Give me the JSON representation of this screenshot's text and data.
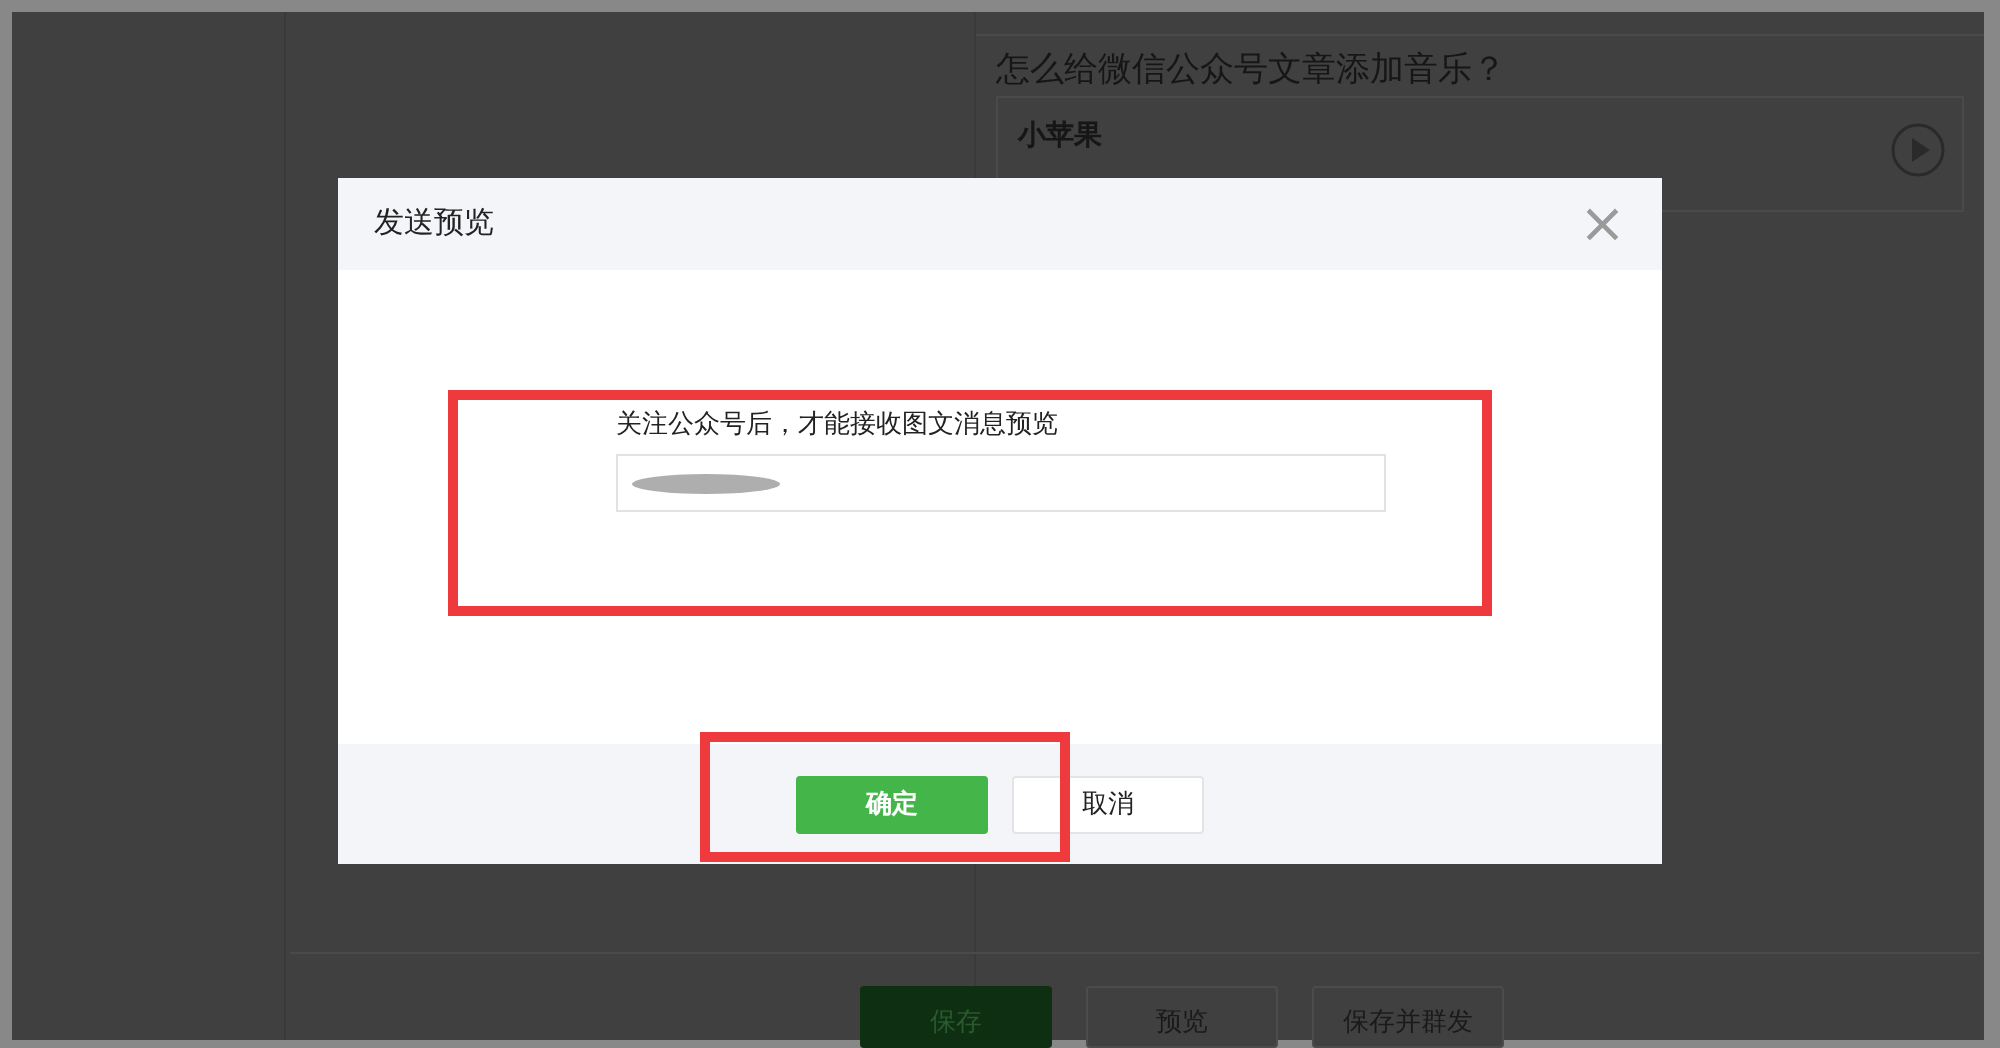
{
  "editor": {
    "article_title": "怎么给微信公众号文章添加音乐？",
    "music_card": {
      "title": "小苹果"
    }
  },
  "bottom_buttons": [
    {
      "label": "保存",
      "kind": "primary"
    },
    {
      "label": "预览",
      "kind": "default"
    },
    {
      "label": "保存并群发",
      "kind": "default"
    }
  ],
  "dialog": {
    "title": "发送预览",
    "close": "×",
    "hint": "关注公众号后，才能接收图文消息预览",
    "field": {
      "redacted": true,
      "highlighted": true
    },
    "buttons": [
      {
        "label": "确定",
        "kind": "primary",
        "highlighted": true
      },
      {
        "label": "取消",
        "kind": "default"
      }
    ]
  }
}
